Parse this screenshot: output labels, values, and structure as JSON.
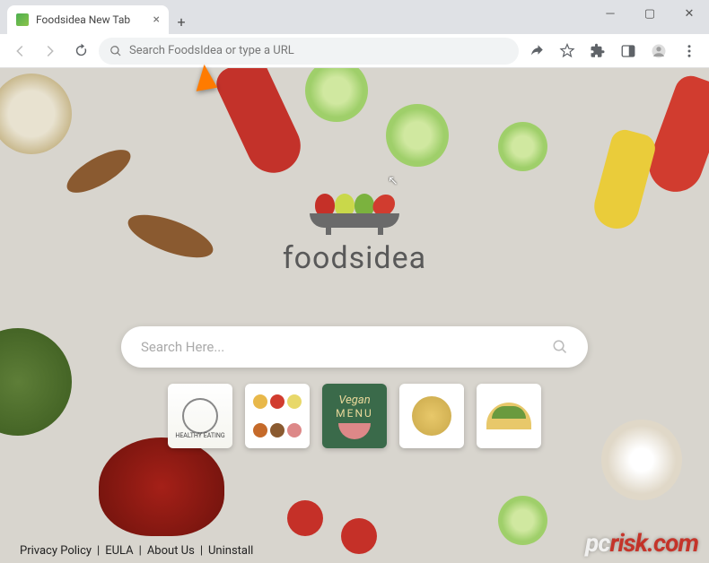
{
  "browser": {
    "tab_title": "Foodsidea New Tab",
    "omnibox_placeholder": "Search FoodsIdea or type a URL",
    "icons": {
      "back": "back-arrow",
      "forward": "forward-arrow",
      "reload": "reload",
      "search": "search",
      "share": "share",
      "star": "star",
      "extensions": "puzzle",
      "sidepanel": "panel",
      "profile": "avatar",
      "menu": "dots"
    }
  },
  "page": {
    "brand": "foodsidea",
    "search_placeholder": "Search Here...",
    "tiles": [
      {
        "name": "healthy-eating",
        "label": "HEALTHY EATING"
      },
      {
        "name": "fast-food",
        "label": ""
      },
      {
        "name": "vegan-menu",
        "label_top": "Vegan",
        "label_bottom": "MENU"
      },
      {
        "name": "pasta",
        "label": ""
      },
      {
        "name": "taco",
        "label": ""
      }
    ],
    "footer_links": [
      {
        "key": "privacy",
        "label": "Privacy Policy"
      },
      {
        "key": "eula",
        "label": "EULA"
      },
      {
        "key": "about",
        "label": "About Us"
      },
      {
        "key": "uninstall",
        "label": "Uninstall"
      }
    ]
  },
  "watermark": {
    "prefix": "pc",
    "suffix": "risk.com"
  }
}
